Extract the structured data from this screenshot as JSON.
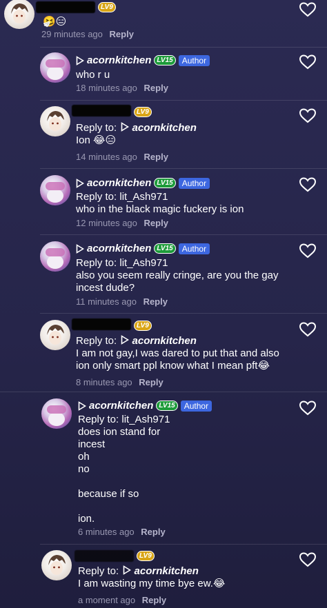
{
  "colors": {
    "background": "#2b2a52",
    "author_tag": "#3d67e0",
    "badge_lv15": "#1d9b3a",
    "badge_lv9": "#d9a516",
    "meta_text": "#9a99b2"
  },
  "comments": [
    {
      "badge": "LV9",
      "body": [
        "🤧😑"
      ],
      "time": "29 minutes ago",
      "reply": "Reply"
    },
    {
      "user": "acornkitchen",
      "badge": "LV15",
      "author": "Author",
      "body": [
        "who r u"
      ],
      "time": "18 minutes ago",
      "reply": "Reply"
    },
    {
      "badge": "LV9",
      "reply_to_label": "Reply to:",
      "reply_to_name": "acornkitchen",
      "body": [
        "Ion 😂😑"
      ],
      "time": "14 minutes ago",
      "reply": "Reply"
    },
    {
      "user": "acornkitchen",
      "badge": "LV15",
      "author": "Author",
      "reply_to_label": "Reply to:",
      "reply_to_name": "lit_Ash971",
      "body": [
        "who in the black magic fuckery is ion"
      ],
      "time": "12 minutes ago",
      "reply": "Reply"
    },
    {
      "user": "acornkitchen",
      "badge": "LV15",
      "author": "Author",
      "reply_to_label": "Reply to:",
      "reply_to_name": "lit_Ash971",
      "body": [
        "also you seem really cringe, are you the gay",
        "incest dude?"
      ],
      "time": "11 minutes ago",
      "reply": "Reply"
    },
    {
      "badge": "LV9",
      "reply_to_label": "Reply to:",
      "reply_to_name": "acornkitchen",
      "body": [
        "I am not gay,I was dared to put that and also",
        "ion only smart ppl know what I mean pft😂"
      ],
      "time": "8 minutes ago",
      "reply": "Reply"
    },
    {
      "user": "acornkitchen",
      "badge": "LV15",
      "author": "Author",
      "reply_to_label": "Reply to:",
      "reply_to_name": "lit_Ash971",
      "body": [
        "does ion stand for",
        "incest",
        "oh",
        "no",
        "",
        "because if so",
        "",
        "ion."
      ],
      "time": "6 minutes ago",
      "reply": "Reply"
    },
    {
      "badge": "LV9",
      "reply_to_label": "Reply to:",
      "reply_to_name": "acornkitchen",
      "body": [
        "I am wasting my time bye ew.😂"
      ],
      "time": "a moment ago",
      "reply": "Reply"
    }
  ]
}
